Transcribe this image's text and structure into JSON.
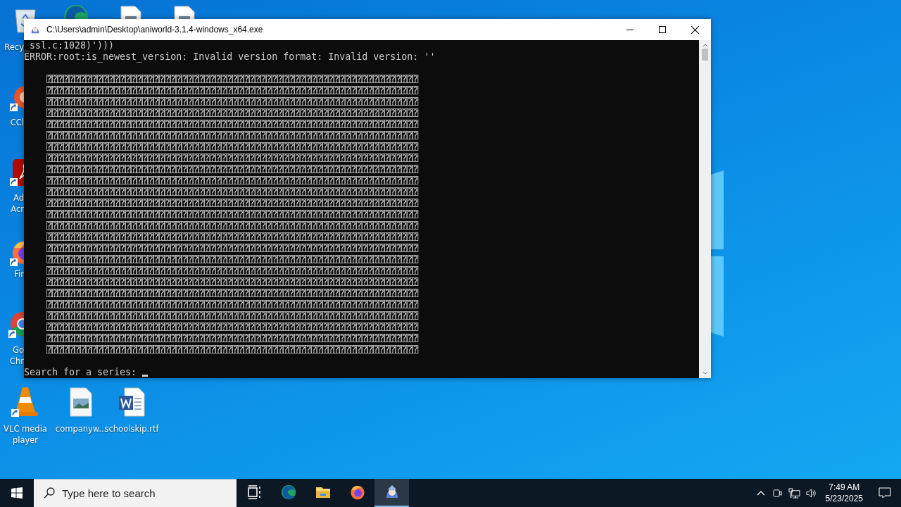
{
  "desktop_icons": [
    {
      "kind": "recycle-bin",
      "lines": [
        "Recy"
      ]
    },
    {
      "kind": "edge"
    },
    {
      "kind": "blank-file"
    },
    {
      "kind": "blank-file"
    },
    {
      "kind": "ccleaner",
      "lines": [
        "CCl"
      ]
    },
    {
      "kind": "acrobat",
      "lines": [
        "Ad",
        "Acr"
      ]
    },
    {
      "kind": "firefox",
      "lines": [
        "Fir"
      ]
    },
    {
      "kind": "chrome",
      "lines": [
        "Go",
        "Chr"
      ]
    },
    {
      "kind": "vlc",
      "lines": [
        "VLC media",
        "player"
      ]
    },
    {
      "kind": "image-file",
      "lines": [
        "companyw..."
      ]
    },
    {
      "kind": "word-file",
      "lines": [
        "schoolskip.rtf"
      ]
    }
  ],
  "window": {
    "title": "C:\\Users\\admin\\Desktop\\aniworld-3.1.4-windows_x64.exe",
    "console": {
      "lines": [
        "_ssl.c:1028)')))",
        "ERROR:root:is_newest_version: Invalid version format: Invalid version: ''"
      ],
      "glyph_rows": [
        "⍰⍰⍰⍰⍰⍰⍰⍰⍰⍰⍰⍰⍰⍰⍰⍰⍰⍰⍰⍰⍰⍰⍰⍰⍰⍰⍰⍰⍰⍰⍰⍰⍰⍰⍰⍰⍰⍰⍰⍰⍰⍰⍰⍰⍰⍰⍰⍰⍰⍰⍰⍰⍰⍰⍰⍰⍰⍰⍰⍰⍰⍰⍰⍰⍰⍰",
        "⍰⍰⍰⍰⍰⍰⍰⍰⍰⍰⍰⍰⍰⍰⍰⍰⍰⍰⍰⍰⍰⍰⍰⍰⍰⍰⍰⍰⍰⍰⍰⍰⍰⍰⍰⍰⍰⍰⍰⍰⍰⍰⍰⍰⍰⍰⍰⍰⍰⍰⍰⍰⍰⍰⍰⍰⍰⍰⍰⍰⍰⍰⍰⍰⍰⍰",
        "⍰⍰⍰⍰⍰⍰⍰⍰⍰⍰⍰⍰⍰⍰⍰⍰⍰⍰⍰⍰⍰⍰⍰⍰⍰⍰⍰⍰⍰⍰⍰⍰⍰⍰⍰⍰⍰⍰⍰⍰⍰⍰⍰⍰⍰⍰⍰⍰⍰⍰⍰⍰⍰⍰⍰⍰⍰⍰⍰⍰⍰⍰⍰⍰⍰⍰",
        "⍰⍰⍰⍰⍰⍰⍰⍰⍰⍰⍰⍰⍰⍰⍰⍰⍰⍰⍰⍰⍰⍰⍰⍰⍰⍰⍰⍰⍰⍰⍰⍰⍰⍰⍰⍰⍰⍰⍰⍰⍰⍰⍰⍰⍰⍰⍰⍰⍰⍰⍰⍰⍰⍰⍰⍰⍰⍰⍰⍰⍰⍰⍰⍰⍰⍰",
        "⍰⍰⍰⍰⍰⍰⍰⍰⍰⍰⍰⍰⍰⍰⍰⍰⍰⍰⍰⍰⍰⍰⍰⍰⍰⍰⍰⍰⍰⍰⍰⍰⍰⍰⍰⍰⍰⍰⍰⍰⍰⍰⍰⍰⍰⍰⍰⍰⍰⍰⍰⍰⍰⍰⍰⍰⍰⍰⍰⍰⍰⍰⍰⍰⍰⍰",
        "⍰⍰⍰⍰⍰⍰⍰⍰⍰⍰⍰⍰⍰⍰⍰⍰⍰⍰⍰⍰⍰⍰⍰⍰⍰⍰⍰⍰⍰⍰⍰⍰⍰⍰⍰⍰⍰⍰⍰⍰⍰⍰⍰⍰⍰⍰⍰⍰⍰⍰⍰⍰⍰⍰⍰⍰⍰⍰⍰⍰⍰⍰⍰⍰⍰⍰",
        "⍰⍰⍰⍰⍰⍰⍰⍰⍰⍰⍰⍰⍰⍰⍰⍰⍰⍰⍰⍰⍰⍰⍰⍰⍰⍰⍰⍰⍰⍰⍰⍰⍰⍰⍰⍰⍰⍰⍰⍰⍰⍰⍰⍰⍰⍰⍰⍰⍰⍰⍰⍰⍰⍰⍰⍰⍰⍰⍰⍰⍰⍰⍰⍰⍰⍰",
        "⍰⍰⍰⍰⍰⍰⍰⍰⍰⍰⍰⍰⍰⍰⍰⍰⍰⍰⍰⍰⍰⍰⍰⍰⍰⍰⍰⍰⍰⍰⍰⍰⍰⍰⍰⍰⍰⍰⍰⍰⍰⍰⍰⍰⍰⍰⍰⍰⍰⍰⍰⍰⍰⍰⍰⍰⍰⍰⍰⍰⍰⍰⍰⍰⍰⍰",
        "⍰⍰⍰⍰⍰⍰⍰⍰⍰⍰⍰⍰⍰⍰⍰⍰⍰⍰⍰⍰⍰⍰⍰⍰⍰⍰⍰⍰⍰⍰⍰⍰⍰⍰⍰⍰⍰⍰⍰⍰⍰⍰⍰⍰⍰⍰⍰⍰⍰⍰⍰⍰⍰⍰⍰⍰⍰⍰⍰⍰⍰⍰⍰⍰⍰⍰",
        "⍰⍰⍰⍰⍰⍰⍰⍰⍰⍰⍰⍰⍰⍰⍰⍰⍰⍰⍰⍰⍰⍰⍰⍰⍰⍰⍰⍰⍰⍰⍰⍰⍰⍰⍰⍰⍰⍰⍰⍰⍰⍰⍰⍰⍰⍰⍰⍰⍰⍰⍰⍰⍰⍰⍰⍰⍰⍰⍰⍰⍰⍰⍰⍰⍰⍰",
        "⍰⍰⍰⍰⍰⍰⍰⍰⍰⍰⍰⍰⍰⍰⍰⍰⍰⍰⍰⍰⍰⍰⍰⍰⍰⍰⍰⍰⍰⍰⍰⍰⍰⍰⍰⍰⍰⍰⍰⍰⍰⍰⍰⍰⍰⍰⍰⍰⍰⍰⍰⍰⍰⍰⍰⍰⍰⍰⍰⍰⍰⍰⍰⍰⍰⍰",
        "⍰⍰⍰⍰⍰⍰⍰⍰⍰⍰⍰⍰⍰⍰⍰⍰⍰⍰⍰⍰⍰⍰⍰⍰⍰⍰⍰⍰⍰⍰⍰⍰⍰⍰⍰⍰⍰⍰⍰⍰⍰⍰⍰⍰⍰⍰⍰⍰⍰⍰⍰⍰⍰⍰⍰⍰⍰⍰⍰⍰⍰⍰⍰⍰⍰⍰",
        "⍰⍰⍰⍰⍰⍰⍰⍰⍰⍰⍰⍰⍰⍰⍰⍰⍰⍰⍰⍰⍰⍰⍰⍰⍰⍰⍰⍰⍰⍰⍰⍰⍰⍰⍰⍰⍰⍰⍰⍰⍰⍰⍰⍰⍰⍰⍰⍰⍰⍰⍰⍰⍰⍰⍰⍰⍰⍰⍰⍰⍰⍰⍰⍰⍰⍰",
        "⍰⍰⍰⍰⍰⍰⍰⍰⍰⍰⍰⍰⍰⍰⍰⍰⍰⍰⍰⍰⍰⍰⍰⍰⍰⍰⍰⍰⍰⍰⍰⍰⍰⍰⍰⍰⍰⍰⍰⍰⍰⍰⍰⍰⍰⍰⍰⍰⍰⍰⍰⍰⍰⍰⍰⍰⍰⍰⍰⍰⍰⍰⍰⍰⍰⍰",
        "⍰⍰⍰⍰⍰⍰⍰⍰⍰⍰⍰⍰⍰⍰⍰⍰⍰⍰⍰⍰⍰⍰⍰⍰⍰⍰⍰⍰⍰⍰⍰⍰⍰⍰⍰⍰⍰⍰⍰⍰⍰⍰⍰⍰⍰⍰⍰⍰⍰⍰⍰⍰⍰⍰⍰⍰⍰⍰⍰⍰⍰⍰⍰⍰⍰⍰",
        "⍰⍰⍰⍰⍰⍰⍰⍰⍰⍰⍰⍰⍰⍰⍰⍰⍰⍰⍰⍰⍰⍰⍰⍰⍰⍰⍰⍰⍰⍰⍰⍰⍰⍰⍰⍰⍰⍰⍰⍰⍰⍰⍰⍰⍰⍰⍰⍰⍰⍰⍰⍰⍰⍰⍰⍰⍰⍰⍰⍰⍰⍰⍰⍰⍰⍰",
        "⍰⍰⍰⍰⍰⍰⍰⍰⍰⍰⍰⍰⍰⍰⍰⍰⍰⍰⍰⍰⍰⍰⍰⍰⍰⍰⍰⍰⍰⍰⍰⍰⍰⍰⍰⍰⍰⍰⍰⍰⍰⍰⍰⍰⍰⍰⍰⍰⍰⍰⍰⍰⍰⍰⍰⍰⍰⍰⍰⍰⍰⍰⍰⍰⍰⍰",
        "⍰⍰⍰⍰⍰⍰⍰⍰⍰⍰⍰⍰⍰⍰⍰⍰⍰⍰⍰⍰⍰⍰⍰⍰⍰⍰⍰⍰⍰⍰⍰⍰⍰⍰⍰⍰⍰⍰⍰⍰⍰⍰⍰⍰⍰⍰⍰⍰⍰⍰⍰⍰⍰⍰⍰⍰⍰⍰⍰⍰⍰⍰⍰⍰⍰⍰",
        "⍰⍰⍰⍰⍰⍰⍰⍰⍰⍰⍰⍰⍰⍰⍰⍰⍰⍰⍰⍰⍰⍰⍰⍰⍰⍰⍰⍰⍰⍰⍰⍰⍰⍰⍰⍰⍰⍰⍰⍰⍰⍰⍰⍰⍰⍰⍰⍰⍰⍰⍰⍰⍰⍰⍰⍰⍰⍰⍰⍰⍰⍰⍰⍰⍰⍰",
        "⍰⍰⍰⍰⍰⍰⍰⍰⍰⍰⍰⍰⍰⍰⍰⍰⍰⍰⍰⍰⍰⍰⍰⍰⍰⍰⍰⍰⍰⍰⍰⍰⍰⍰⍰⍰⍰⍰⍰⍰⍰⍰⍰⍰⍰⍰⍰⍰⍰⍰⍰⍰⍰⍰⍰⍰⍰⍰⍰⍰⍰⍰⍰⍰⍰⍰",
        "⍰⍰⍰⍰⍰⍰⍰⍰⍰⍰⍰⍰⍰⍰⍰⍰⍰⍰⍰⍰⍰⍰⍰⍰⍰⍰⍰⍰⍰⍰⍰⍰⍰⍰⍰⍰⍰⍰⍰⍰⍰⍰⍰⍰⍰⍰⍰⍰⍰⍰⍰⍰⍰⍰⍰⍰⍰⍰⍰⍰⍰⍰⍰⍰⍰⍰",
        "⍰⍰⍰⍰⍰⍰⍰⍰⍰⍰⍰⍰⍰⍰⍰⍰⍰⍰⍰⍰⍰⍰⍰⍰⍰⍰⍰⍰⍰⍰⍰⍰⍰⍰⍰⍰⍰⍰⍰⍰⍰⍰⍰⍰⍰⍰⍰⍰⍰⍰⍰⍰⍰⍰⍰⍰⍰⍰⍰⍰⍰⍰⍰⍰⍰⍰",
        "⍰⍰⍰⍰⍰⍰⍰⍰⍰⍰⍰⍰⍰⍰⍰⍰⍰⍰⍰⍰⍰⍰⍰⍰⍰⍰⍰⍰⍰⍰⍰⍰⍰⍰⍰⍰⍰⍰⍰⍰⍰⍰⍰⍰⍰⍰⍰⍰⍰⍰⍰⍰⍰⍰⍰⍰⍰⍰⍰⍰⍰⍰⍰⍰⍰⍰",
        "⍰⍰⍰⍰⍰⍰⍰⍰⍰⍰⍰⍰⍰⍰⍰⍰⍰⍰⍰⍰⍰⍰⍰⍰⍰⍰⍰⍰⍰⍰⍰⍰⍰⍰⍰⍰⍰⍰⍰⍰⍰⍰⍰⍰⍰⍰⍰⍰⍰⍰⍰⍰⍰⍰⍰⍰⍰⍰⍰⍰⍰⍰⍰⍰⍰⍰",
        "⍰⍰⍰⍰⍰⍰⍰⍰⍰⍰⍰⍰⍰⍰⍰⍰⍰⍰⍰⍰⍰⍰⍰⍰⍰⍰⍰⍰⍰⍰⍰⍰⍰⍰⍰⍰⍰⍰⍰⍰⍰⍰⍰⍰⍰⍰⍰⍰⍰⍰⍰⍰⍰⍰⍰⍰⍰⍰⍰⍰⍰⍰⍰⍰⍰⍰"
      ],
      "prompt": "Search for a series:"
    }
  },
  "taskbar": {
    "search": {
      "placeholder": "Type here to search"
    },
    "apps": [
      {
        "kind": "task-view",
        "selected": false
      },
      {
        "kind": "edge",
        "selected": false
      },
      {
        "kind": "explorer",
        "selected": false
      },
      {
        "kind": "firefox",
        "selected": false
      },
      {
        "kind": "aniworld",
        "selected": true
      }
    ],
    "clock": {
      "time": "7:49 AM",
      "date": "5/23/2025"
    }
  }
}
